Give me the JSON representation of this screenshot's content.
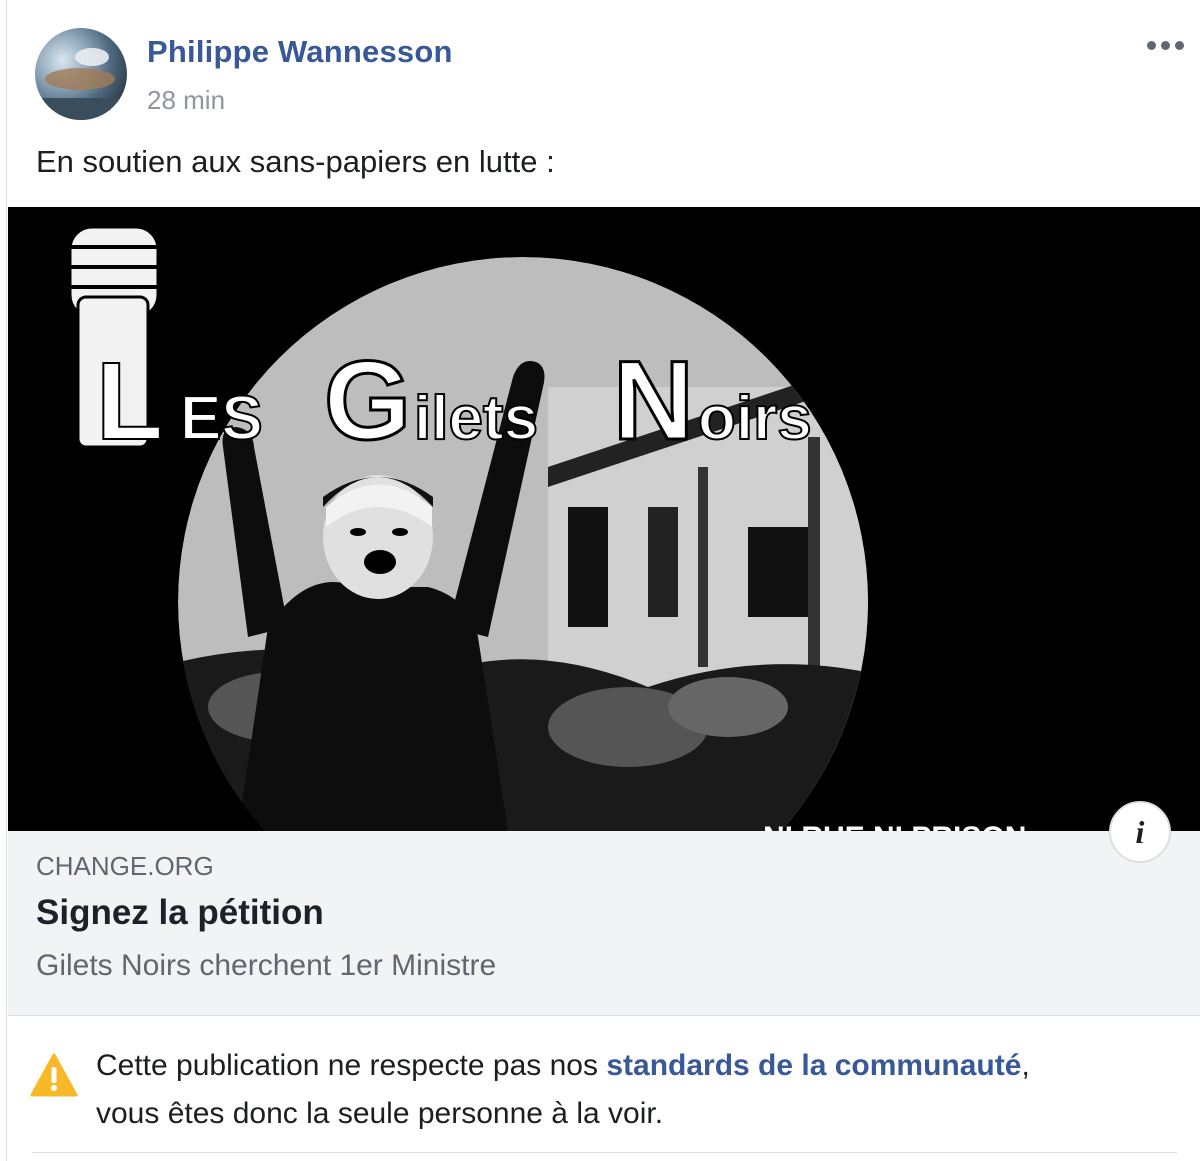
{
  "post": {
    "author": "Philippe Wannesson",
    "timestamp": "28 min",
    "text": "En soutien aux sans-papiers en lutte :",
    "more_icon": "ellipsis-icon"
  },
  "link_preview": {
    "image": {
      "title_words": [
        "L",
        "ES",
        "G",
        "ilets",
        "N",
        "oirs"
      ],
      "bottom_caption": "NI RUE NI PRISON",
      "info_label": "i"
    },
    "domain": "CHANGE.ORG",
    "title": "Signez la pétition",
    "description": "Gilets Noirs cherchent 1er Ministre"
  },
  "warning": {
    "icon": "warning-icon",
    "text_before": "Cette publication ne respecte pas nos ",
    "link": "standards de la communauté",
    "text_after": ",",
    "line2": "vous êtes donc la seule personne à la voir."
  },
  "colors": {
    "link_blue": "#385898",
    "warning_yellow": "#f7b928",
    "meta_background": "#f2f3f5"
  }
}
